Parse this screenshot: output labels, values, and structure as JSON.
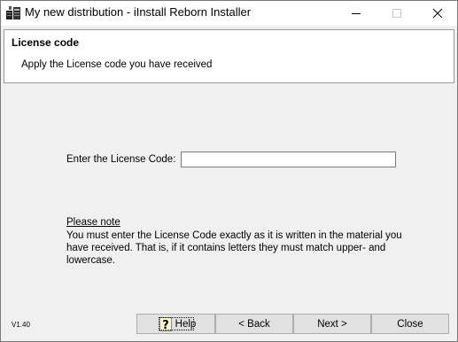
{
  "window": {
    "title": "My new distribution - iInstall Reborn Installer",
    "app_icon": "installer-icon",
    "controls": [
      "minimize-icon",
      "maximize-icon",
      "close-icon"
    ]
  },
  "header": {
    "title": "License code",
    "subtitle": "Apply the License code you have received"
  },
  "form": {
    "license_label": "Enter the License Code:",
    "license_value": ""
  },
  "note": {
    "title": "Please note",
    "body": "You must enter the License Code exactly as it is written in the material you have received. That is, if it contains letters they must match upper- and lowercase."
  },
  "footer": {
    "version": "V1.40",
    "help_label": "Help",
    "help_icon": "question-mark-icon",
    "back_label": "< Back",
    "next_label": "Next >",
    "cancel_label": "Close"
  }
}
